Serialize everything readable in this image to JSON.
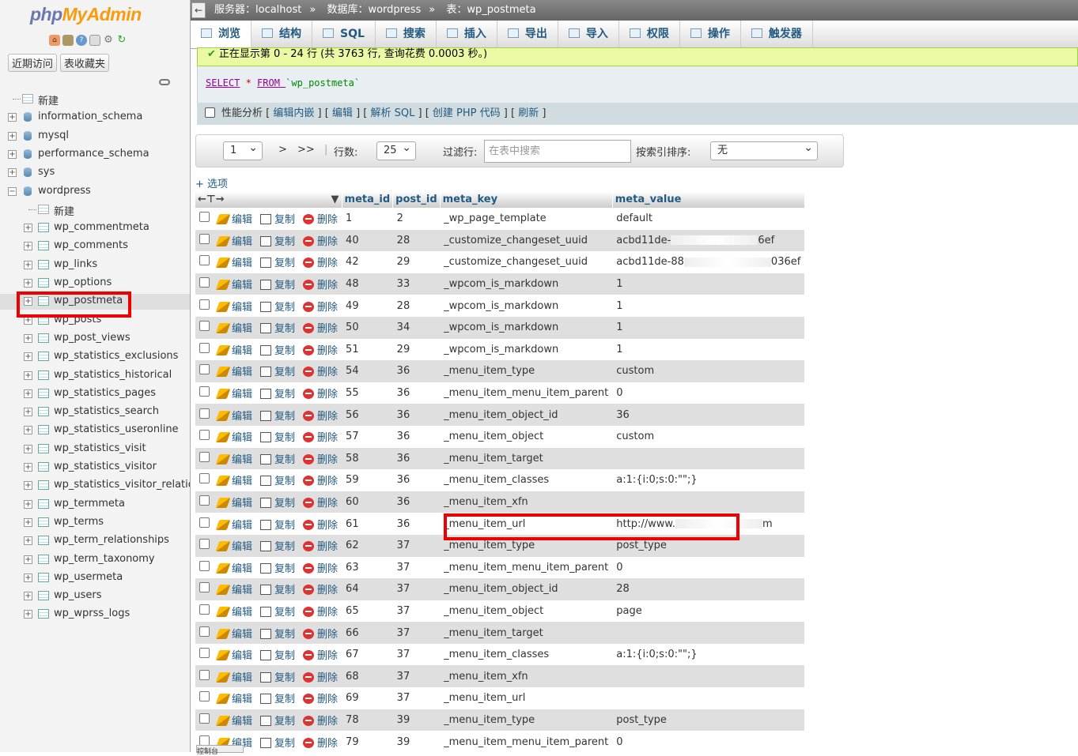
{
  "logo": {
    "a": "php",
    "b": "MyAdmin"
  },
  "left": {
    "tabs": [
      "近期访问",
      "表收藏夹"
    ],
    "tree": [
      {
        "label": "新建",
        "kind": "new",
        "level": 0
      },
      {
        "label": "information_schema",
        "kind": "db",
        "level": 0
      },
      {
        "label": "mysql",
        "kind": "db",
        "level": 0
      },
      {
        "label": "performance_schema",
        "kind": "db",
        "level": 0
      },
      {
        "label": "sys",
        "kind": "db",
        "level": 0
      },
      {
        "label": "wordpress",
        "kind": "db",
        "level": 0,
        "open": true
      },
      {
        "label": "新建",
        "kind": "new",
        "level": 1
      },
      {
        "label": "wp_commentmeta",
        "kind": "tbl",
        "level": 1
      },
      {
        "label": "wp_comments",
        "kind": "tbl",
        "level": 1
      },
      {
        "label": "wp_links",
        "kind": "tbl",
        "level": 1
      },
      {
        "label": "wp_options",
        "kind": "tbl",
        "level": 1
      },
      {
        "label": "wp_postmeta",
        "kind": "tbl",
        "level": 1,
        "selected": true
      },
      {
        "label": "wp_posts",
        "kind": "tbl",
        "level": 1
      },
      {
        "label": "wp_post_views",
        "kind": "tbl",
        "level": 1
      },
      {
        "label": "wp_statistics_exclusions",
        "kind": "tbl",
        "level": 1
      },
      {
        "label": "wp_statistics_historical",
        "kind": "tbl",
        "level": 1
      },
      {
        "label": "wp_statistics_pages",
        "kind": "tbl",
        "level": 1
      },
      {
        "label": "wp_statistics_search",
        "kind": "tbl",
        "level": 1
      },
      {
        "label": "wp_statistics_useronline",
        "kind": "tbl",
        "level": 1
      },
      {
        "label": "wp_statistics_visit",
        "kind": "tbl",
        "level": 1
      },
      {
        "label": "wp_statistics_visitor",
        "kind": "tbl",
        "level": 1
      },
      {
        "label": "wp_statistics_visitor_relationships",
        "kind": "tbl",
        "level": 1
      },
      {
        "label": "wp_termmeta",
        "kind": "tbl",
        "level": 1
      },
      {
        "label": "wp_terms",
        "kind": "tbl",
        "level": 1
      },
      {
        "label": "wp_term_relationships",
        "kind": "tbl",
        "level": 1
      },
      {
        "label": "wp_term_taxonomy",
        "kind": "tbl",
        "level": 1
      },
      {
        "label": "wp_usermeta",
        "kind": "tbl",
        "level": 1
      },
      {
        "label": "wp_users",
        "kind": "tbl",
        "level": 1
      },
      {
        "label": "wp_wprss_logs",
        "kind": "tbl",
        "level": 1
      }
    ]
  },
  "breadcrumb": {
    "server": "服务器：localhost",
    "sep": "»",
    "db": "数据库：wordpress",
    "table": "表：wp_postmeta"
  },
  "tabs": [
    "浏览",
    "结构",
    "SQL",
    "搜索",
    "插入",
    "导出",
    "导入",
    "权限",
    "操作",
    "触发器"
  ],
  "success": "正在显示第 0 - 24 行 (共 3763 行, 查询花费 0.0003 秒。)",
  "sql": {
    "select": "SELECT",
    "star": " * ",
    "from": "FROM ",
    "table": "`wp_postmeta`"
  },
  "profiling": {
    "label": "性能分析",
    "links": [
      "编辑内嵌",
      "编辑",
      "解析 SQL",
      "创建 PHP 代码",
      "刷新"
    ]
  },
  "nav": {
    "page": "1",
    "next": ">",
    "last": ">>",
    "rows_label": "行数:",
    "rows": "25",
    "filter_label": "过滤行:",
    "filter_placeholder": "在表中搜索",
    "sort_label": "按索引排序:",
    "sort": "无"
  },
  "options_link": "+ 选项",
  "columns": [
    "meta_id",
    "post_id",
    "meta_key",
    "meta_value"
  ],
  "actions": {
    "edit": "编辑",
    "copy": "复制",
    "delete": "删除"
  },
  "rows": [
    [
      "1",
      "2",
      "_wp_page_template",
      "default"
    ],
    [
      "40",
      "28",
      "_customize_changeset_uuid",
      "acbd11de-",
      "6ef"
    ],
    [
      "42",
      "29",
      "_customize_changeset_uuid",
      "acbd11de-88",
      "036ef"
    ],
    [
      "48",
      "33",
      "_wpcom_is_markdown",
      "1"
    ],
    [
      "49",
      "28",
      "_wpcom_is_markdown",
      "1"
    ],
    [
      "50",
      "34",
      "_wpcom_is_markdown",
      "1"
    ],
    [
      "51",
      "29",
      "_wpcom_is_markdown",
      "1"
    ],
    [
      "54",
      "36",
      "_menu_item_type",
      "custom"
    ],
    [
      "55",
      "36",
      "_menu_item_menu_item_parent",
      "0"
    ],
    [
      "56",
      "36",
      "_menu_item_object_id",
      "36"
    ],
    [
      "57",
      "36",
      "_menu_item_object",
      "custom"
    ],
    [
      "58",
      "36",
      "_menu_item_target",
      ""
    ],
    [
      "59",
      "36",
      "_menu_item_classes",
      "a:1:{i:0;s:0:\"\";}"
    ],
    [
      "60",
      "36",
      "_menu_item_xfn",
      ""
    ],
    [
      "61",
      "36",
      "_menu_item_url",
      "http://www.",
      "m"
    ],
    [
      "62",
      "37",
      "_menu_item_type",
      "post_type"
    ],
    [
      "63",
      "37",
      "_menu_item_menu_item_parent",
      "0"
    ],
    [
      "64",
      "37",
      "_menu_item_object_id",
      "28"
    ],
    [
      "65",
      "37",
      "_menu_item_object",
      "page"
    ],
    [
      "66",
      "37",
      "_menu_item_target",
      ""
    ],
    [
      "67",
      "37",
      "_menu_item_classes",
      "a:1:{i:0;s:0:\"\";}"
    ],
    [
      "68",
      "37",
      "_menu_item_xfn",
      ""
    ],
    [
      "69",
      "37",
      "_menu_item_url",
      ""
    ],
    [
      "78",
      "39",
      "_menu_item_type",
      "post_type"
    ],
    [
      "79",
      "39",
      "_menu_item_menu_item_parent",
      "0"
    ]
  ],
  "console": "控制台"
}
